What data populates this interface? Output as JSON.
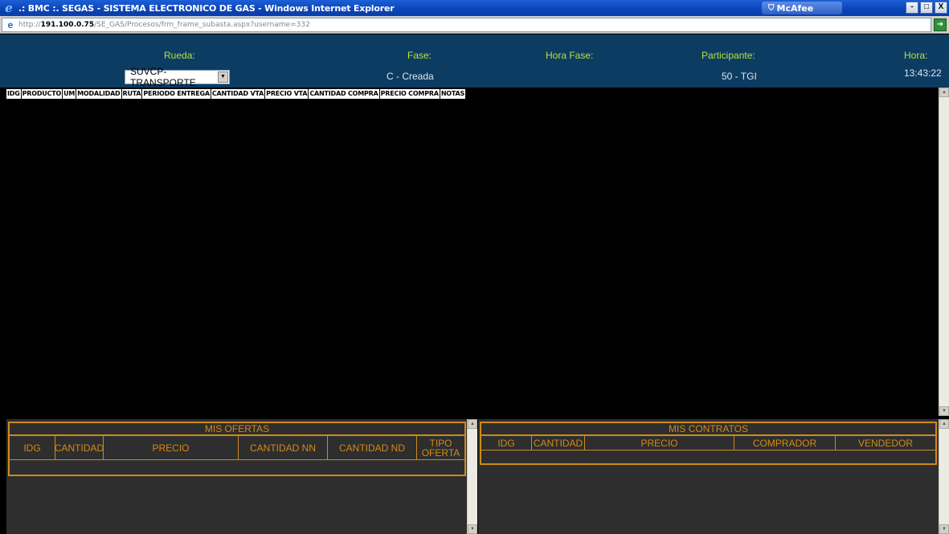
{
  "window": {
    "title": ".: BMC :. SEGAS - SISTEMA ELECTRONICO DE GAS - Windows Internet Explorer",
    "mcafee": "McAfee",
    "controls": [
      "-",
      "□",
      "X"
    ]
  },
  "address": {
    "url_prefix": "http://",
    "url_host": "191.100.0.75",
    "url_path": "/SE_GAS/Procesos/frm_frame_subasta.aspx?username=332"
  },
  "header": {
    "rueda_label": "Rueda:",
    "rueda_value": "SUVCP-TRANSPORTE",
    "fase_label": "Fase:",
    "fase_value": "C - Creada",
    "hora_fase_label": "Hora Fase:",
    "participante_label": "Participante:",
    "participante_value": "50 - TGI",
    "hora_label": "Hora:",
    "hora_value": "13:43:22"
  },
  "columns": [
    "IDG",
    "PRODUCTO",
    "UM",
    "MODALIDAD",
    "RUTA",
    "PERIODO ENTREGA",
    "CANTIDAD VTA",
    "PRECIO VTA",
    "CANTIDAD COMPRA",
    "PRECIO COMPRA",
    "NOTAS"
  ],
  "mis_ofertas": {
    "title": "MIS OFERTAS",
    "headers": [
      "IDG",
      "CANTIDAD",
      "PRECIO",
      "CANTIDAD NN",
      "CANTIDAD ND",
      "TIPO OFERTA"
    ]
  },
  "mis_contratos": {
    "title": "MIS CONTRATOS",
    "headers": [
      "IDG",
      "CANTIDAD",
      "PRECIO",
      "COMPRADOR",
      "VENDEDOR"
    ]
  },
  "colors": {
    "header_bg": "#0d3c63",
    "label_green": "#b5e33f",
    "table_orange": "#d08a18",
    "frame_bg": "#2e2e2e"
  }
}
